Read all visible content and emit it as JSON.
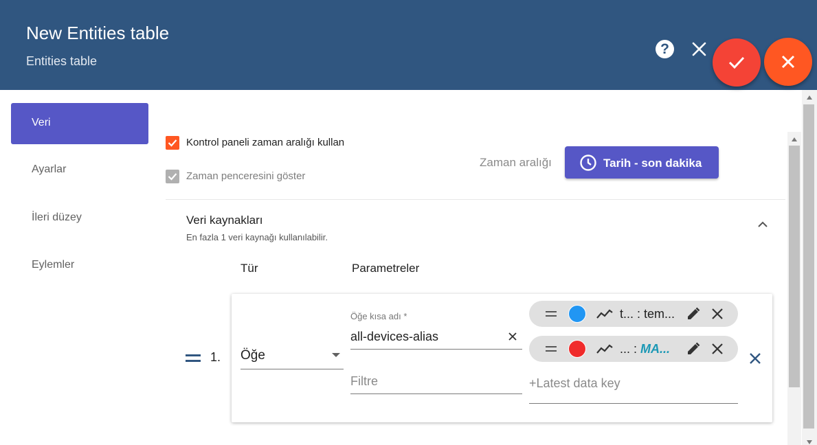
{
  "dialog": {
    "title": "New Entities table",
    "subtitle": "Entities table",
    "help_icon": "help-circle-icon",
    "close_icon": "close-icon",
    "apply_icon": "check-icon",
    "decline_icon": "close-icon",
    "colors": {
      "header": "#305680",
      "apply": "#f44336",
      "decline": "#ff5722",
      "primary": "#5657c6"
    }
  },
  "sidebar": {
    "items": [
      {
        "label": "Veri",
        "active": true
      },
      {
        "label": "Ayarlar",
        "active": false
      },
      {
        "label": "İleri düzey",
        "active": false
      },
      {
        "label": "Eylemler",
        "active": false
      }
    ]
  },
  "timewindow": {
    "use_dashboard_label": "Kontrol paneli zaman aralığı kullan",
    "use_dashboard_checked": true,
    "show_window_label": "Zaman penceresini göster",
    "show_window_checked": true,
    "time_label": "Zaman aralığı",
    "button_label": "Tarih - son dakika",
    "button_icon": "clock-icon"
  },
  "datasources": {
    "title": "Veri kaynakları",
    "hint": "En fazla 1 veri kaynağı kullanılabilir.",
    "collapse_icon": "chevron-up-icon",
    "columns": {
      "type": "Tür",
      "params": "Parametreler"
    },
    "rows": [
      {
        "index": "1.",
        "type": "Öğe",
        "alias_label": "Öğe kısa adı *",
        "alias_value": "all-devices-alias",
        "filter_placeholder": "Filtre",
        "keys": [
          {
            "color": "#2196f3",
            "prefix": "t...",
            "separator": " : ",
            "label": "tem...",
            "accent": false
          },
          {
            "color": "#f02b2b",
            "prefix": "...",
            "separator": " : ",
            "label": "MA...",
            "accent": true
          }
        ],
        "latest_key_placeholder": "+Latest data key"
      }
    ]
  }
}
